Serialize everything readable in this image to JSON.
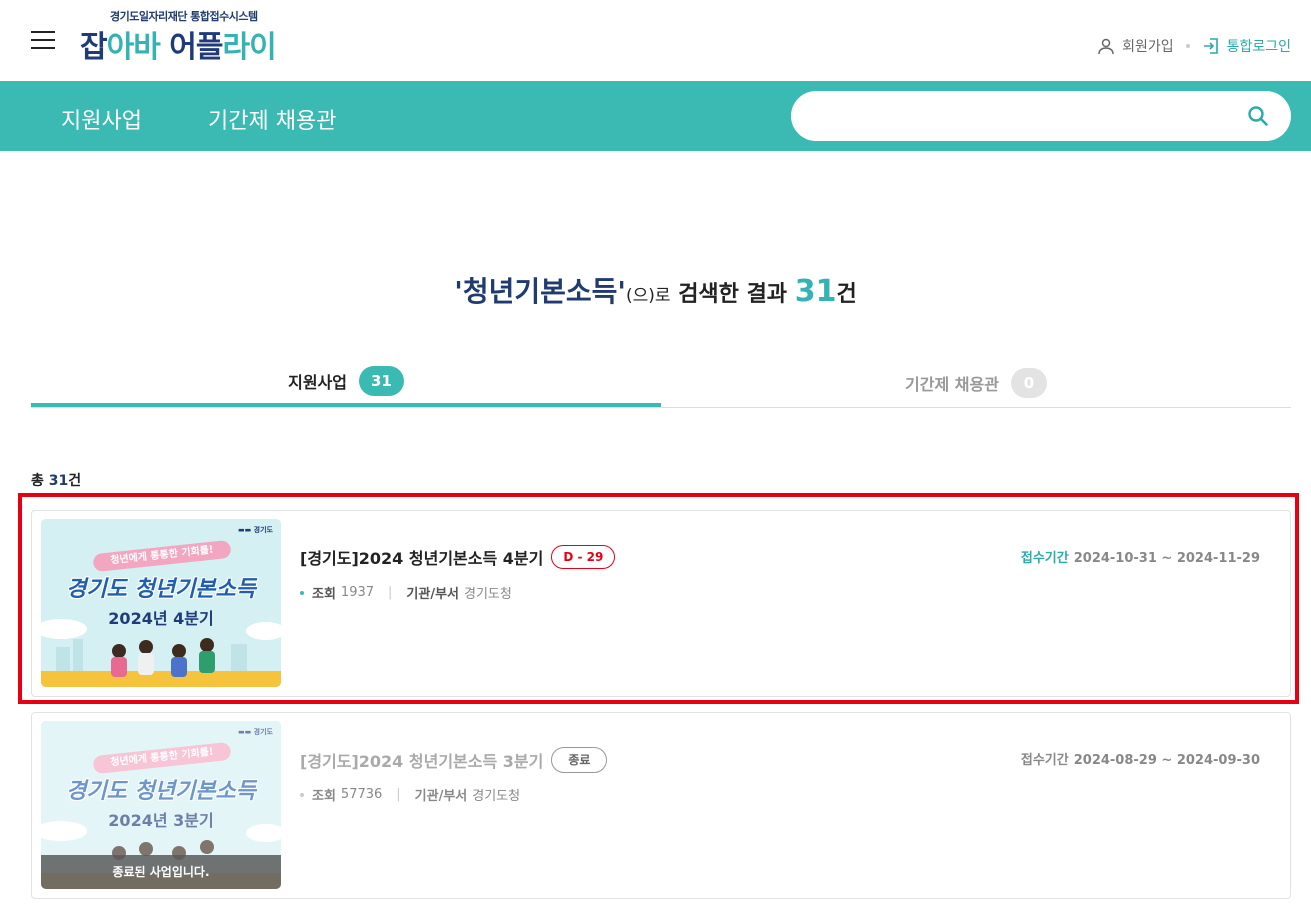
{
  "header": {
    "logo_sub": "경기도일자리재단 통합접수시스템",
    "logo_part1": "잡",
    "logo_part2": "아바",
    "logo_part3": " 어플",
    "logo_part4": "라이",
    "join_label": "회원가입",
    "login_label": "통합로그인"
  },
  "nav": {
    "items": [
      "지원사업",
      "기간제 채용관"
    ],
    "search_placeholder": "",
    "search_value": ""
  },
  "result": {
    "keyword": "'청년기본소득'",
    "middle": "(으)로",
    "text": " 검색한 결과 ",
    "count": "31",
    "unit": "건"
  },
  "tabs": [
    {
      "label": "지원사업",
      "count": "31",
      "active": true
    },
    {
      "label": "기간제 채용관",
      "count": "0",
      "active": false
    }
  ],
  "total": {
    "prefix": "총 ",
    "count": "31",
    "unit": "건"
  },
  "cards": [
    {
      "thumb_ribbon": "청년에게 통통한 기회를!",
      "thumb_title": "경기도 청년기본소득",
      "thumb_sub": "2024년 4분기",
      "title": "[경기도]2024 청년기본소득 4분기",
      "badge": "D - 29",
      "views_label": "조회",
      "views": "1937",
      "dept_label": "기관/부서",
      "dept": "경기도청",
      "period_label": "접수기간",
      "period": "2024-10-31 ~ 2024-11-29"
    },
    {
      "thumb_ribbon": "청년에게 통통한 기회를!",
      "thumb_title": "경기도 청년기본소득",
      "thumb_sub": "2024년 3분기",
      "ended_text": "종료된 사업입니다.",
      "title": "[경기도]2024 청년기본소득 3분기",
      "badge": "종료",
      "views_label": "조회",
      "views": "57736",
      "dept_label": "기관/부서",
      "dept": "경기도청",
      "period_label": "접수기간",
      "period": "2024-08-29 ~ 2024-09-30"
    }
  ],
  "colors": {
    "brand_teal": "#3bbab3",
    "brand_navy": "#1f3b6f",
    "highlight_red": "#e60012"
  }
}
